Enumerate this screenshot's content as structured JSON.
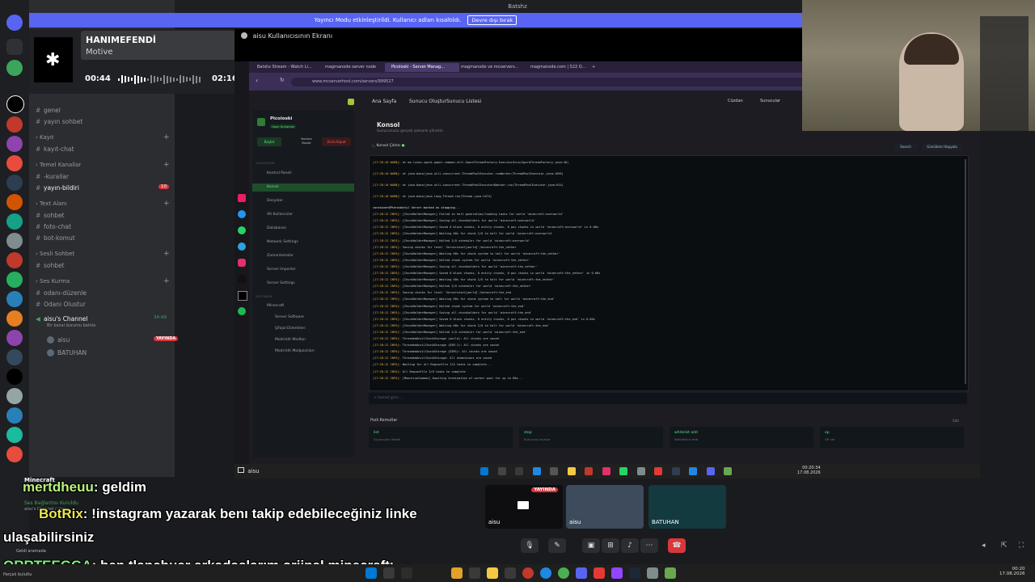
{
  "window_title": "Batshz",
  "banner": {
    "text": "Yayıncı Modu etkinleştirildi. Kullanıcı adları kısaltıldı.",
    "button": "Devre dışı bırak"
  },
  "music": {
    "title": "HANIMEFENDİ",
    "artist": "Motive",
    "elapsed": "00:44",
    "total": "02:16",
    "progress": 0.32
  },
  "channels": {
    "items": [
      {
        "type": "ch",
        "label": "genel"
      },
      {
        "type": "ch",
        "label": "yayın sohbet"
      },
      {
        "type": "cat",
        "label": "Kayıt"
      },
      {
        "type": "ch",
        "label": "kayıt-chat"
      },
      {
        "type": "cat",
        "label": "Temel Kanallar"
      },
      {
        "type": "ch",
        "label": "-kurallar"
      },
      {
        "type": "ch",
        "label": "yayın-bildiri",
        "badge": "10"
      },
      {
        "type": "cat",
        "label": "Text Alanı"
      },
      {
        "type": "ch",
        "label": "sohbet"
      },
      {
        "type": "ch",
        "label": "foto-chat"
      },
      {
        "type": "ch",
        "label": "bot-komut"
      },
      {
        "type": "cat",
        "label": "Sesli Sohbet"
      },
      {
        "type": "ch",
        "label": "sohbet"
      },
      {
        "type": "cat",
        "label": "Ses Kurma"
      },
      {
        "type": "ch",
        "label": "odanı-düzenle"
      },
      {
        "type": "ch",
        "label": "Odanı Olustur"
      }
    ],
    "voice": {
      "name": "aisu's Channel",
      "status": "Bir kanal durumu belirle",
      "time": "34:49",
      "members": [
        {
          "name": "aisu",
          "live": "YAYINDA"
        },
        {
          "name": "BATUHAN"
        }
      ]
    }
  },
  "stream": {
    "header": "aisu Kullanıcısının Ekranı",
    "tabs": [
      "Batshz Stream - Watch Li...",
      "magmanode server node",
      "Picoloski - Server Manag...",
      "magmanode ve mcservers...",
      "magmanode.com | 522 O..."
    ],
    "url": "www.mcserverhost.com/servers/999527",
    "nav": [
      "Ana Sayfa",
      "Sunucu Oluştur",
      "Sunucu Listesi"
    ],
    "nav_right": [
      "Cüzdan",
      "Sunucular"
    ],
    "server_name": "Picoloski",
    "server_badge": "Hazır Kullanımı",
    "actions": [
      "Başlat",
      "Yeniden Başlat",
      "Zorla Kapat"
    ],
    "sidebar_section": "NAVIGATION",
    "sidebar": [
      "Kontrol Paneli",
      "Konsol",
      "Dosyalar",
      "Alt Kullanıcılar",
      "Databases",
      "Network Settings",
      "Zamanlamalar",
      "Server Importer",
      "Server Settings"
    ],
    "software_section": "SOFTWARE",
    "software": [
      "Minecraft",
      "Server Software",
      "Şifajal Eklentileri",
      "Modrinth Modları",
      "Modrinth Modpackları"
    ],
    "page_title": "Konsol",
    "page_sub": "Sunucunuzu gerçek zamanlı yönetin",
    "console_label": "Konsol Çıktısı",
    "console_search": "Search",
    "console_button": "Günlükleri Kopyala",
    "logs": [
      "[17:28:10 WARN]: at me.lucko.spark.paper.common.util.SparkThreadFactory.Executor$run(SparkThreadFactory.java:40)",
      "[17:28:10 WARN]: at java.base/java.util.concurrent.ThreadPoolExecutor.runWorker(ThreadPoolExecutor.java:1095)",
      "[17:28:10 WARN]: at java.base/java.util.concurrent.ThreadPoolExecutor$Worker.run(ThreadPoolExecutor.java:614)",
      "[17:28:10 WARN]: at java.base/java.lang.Thread.run(Thread.java:1474)",
      "container@Pterodactyl Server marked as stopping...",
      "[17:28:12 INFO]: [ChunkHolderManager] Failed to halt generation/loading tasks for world 'minecraft:overworld'",
      "[17:28:12 INFO]: [ChunkHolderManager] Saving all chunkholders for world 'minecraft:overworld'",
      "[17:28:12 INFO]: [ChunkHolderManager] Saved 0 block chunks, 0 entity chunks, 0 poi chunks in world 'minecraft:overworld' in 0.00s",
      "[17:28:12 INFO]: [ChunkHolderManager] Waiting 60s for chunk I/O to halt for world 'minecraft:overworld'",
      "[17:28:12 INFO]: [ChunkHolderManager] Halted I/O scheduler for world 'minecraft:overworld'",
      "[17:28:12 INFO]: Saving chunks for level 'ServerLevel[world]'/minecraft:the_nether",
      "[17:28:12 INFO]: [ChunkHolderManager] Waiting 60s for chunk system to halt for world 'minecraft:the_nether'",
      "[17:28:12 INFO]: [ChunkHolderManager] Halted chunk system for world 'minecraft:the_nether'",
      "[17:28:12 INFO]: [ChunkHolderManager] Saving all chunkholders for world 'minecraft:the_nether'",
      "[17:28:12 INFO]: [ChunkHolderManager] Saved 0 block chunks, 0 entity chunks, 0 poi chunks in world 'minecraft:the_nether' in 0.00s",
      "[17:28:12 INFO]: [ChunkHolderManager] Waiting 60s for chunk I/O to halt for world 'minecraft:the_nether'",
      "[17:28:12 INFO]: [ChunkHolderManager] Halted I/O scheduler for world 'minecraft:the_nether'",
      "[17:28:12 INFO]: Saving chunks for level 'ServerLevel[world]'/minecraft:the_end",
      "[17:28:12 INFO]: [ChunkHolderManager] Waiting 60s for chunk system to halt for world 'minecraft:the_end'",
      "[17:28:12 INFO]: [ChunkHolderManager] Halted chunk system for world 'minecraft:the_end'",
      "[17:28:12 INFO]: [ChunkHolderManager] Saving all chunkholders for world 'minecraft:the_end'",
      "[17:28:12 INFO]: [ChunkHolderManager] Saved 0 block chunks, 0 entity chunks, 0 poi chunks in world 'minecraft:the_end' in 0.00s",
      "[17:28:12 INFO]: [ChunkHolderManager] Waiting 60s for chunk I/O to halt for world 'minecraft:the_end'",
      "[17:28:12 INFO]: [ChunkHolderManager] Halted I/O scheduler for world 'minecraft:the_end'",
      "[17:28:12 INFO]: ThreadedAnvilChunkStorage (world): All chunks are saved",
      "[17:28:12 INFO]: ThreadedAnvilChunkStorage (DIM-1): All chunks are saved",
      "[17:28:12 INFO]: ThreadedAnvilChunkStorage (DIM1): All chunks are saved",
      "[17:28:12 INFO]: ThreadedAnvilChunkStorage: All dimensions are saved",
      "[17:28:12 INFO]: Waiting for all RegionFile I/O tasks to complete...",
      "[17:28:12 INFO]: All RegionFile I/O tasks to complete",
      "[17:28:12 INFO]: [MoonriseCommon] Awaiting termination of worker pool for up to 60s..."
    ],
    "cmd_placeholder": "> komut girin...",
    "quick_title": "Hızlı Komutlar",
    "quick_edit": "Edit",
    "quick": [
      {
        "cmd": "list",
        "desc": "Oyuncuları listele"
      },
      {
        "cmd": "stop",
        "desc": "Sunucuyu durdur"
      },
      {
        "cmd": "whitelist add",
        "desc": "Whitelist'e ekle"
      },
      {
        "cmd": "op",
        "desc": "OP ver"
      }
    ],
    "clock": "00:20:34",
    "date": "17.08.2026"
  },
  "chat": [
    {
      "user": "mertdheuu",
      "sep": ": ",
      "text": "geldim",
      "color": "#b9f27c"
    },
    {
      "user": "BotRix",
      "sep": ": ",
      "text": "!instagram yazarak benı takip edebileceğiniz linke",
      "color": "#e9e94a"
    },
    {
      "user": "",
      "sep": "",
      "text": "ulaşabilirsiniz",
      "color": "#ffffff"
    },
    {
      "user": "QRRTEEGGA",
      "sep": ": ",
      "text": "ben tlanchuer arkadaşlarım orjinal minecraftı",
      "color": "#7cf27c"
    }
  ],
  "overlay_labels": {
    "minecraft": "Minecraft",
    "voice_connected": "Ses Bağlantısı Kuruldu",
    "server": "aisu's Channel / aisu",
    "bottom_left": "Parçalı bulutlu",
    "bottom_left2": "Geldi aramada"
  },
  "tiles": [
    {
      "name": "aisu",
      "live": "YAYINDA"
    },
    {
      "name": "aisu"
    },
    {
      "name": "BATUHAN"
    }
  ],
  "system": {
    "time": "00:20",
    "date": "17.08.2026"
  },
  "stream_user": "aisu"
}
